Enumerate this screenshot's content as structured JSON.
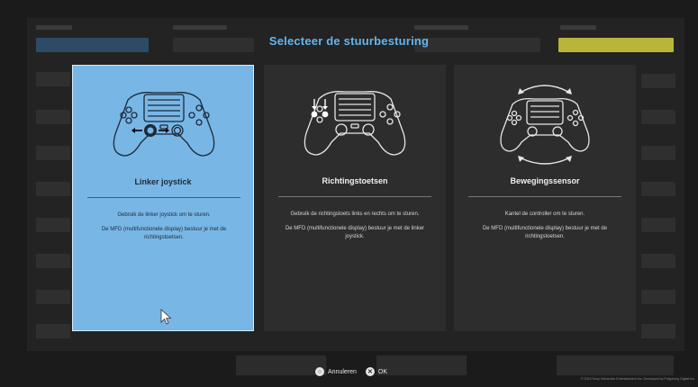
{
  "screen": {
    "title": "Selecteer de stuurbesturing"
  },
  "options": [
    {
      "title": "Linker joystick",
      "line1": "Gebruik de linker joystick om te sturen.",
      "line2": "De MFD (multifunctionele display) bestuur je met de richtingstoetsen.",
      "icon": "controller-left-stick-icon",
      "selected": true
    },
    {
      "title": "Richtingstoetsen",
      "line1": "Gebruik de richtingstoets links en rechts om te sturen.",
      "line2": "De MFD (multifunctionele display) bestuur je met de linker joystick.",
      "icon": "controller-dpad-icon",
      "selected": false
    },
    {
      "title": "Bewegingssensor",
      "line1": "Kantel de controller om te sturen.",
      "line2": "De MFD (multifunctionele display) bestuur je met de richtingstoetsen.",
      "icon": "controller-motion-icon",
      "selected": false
    }
  ],
  "footer": {
    "cancel_label": "Annuleren",
    "ok_label": "OK",
    "copyright": "© 2019 Sony Interactive Entertainment Inc. Developed by Polyphony Digital Inc."
  },
  "colors": {
    "title": "#64b6ee",
    "selected_card": "#78b6e6",
    "card": "#2d2d2d",
    "accent_yellow": "#b9b53a"
  }
}
